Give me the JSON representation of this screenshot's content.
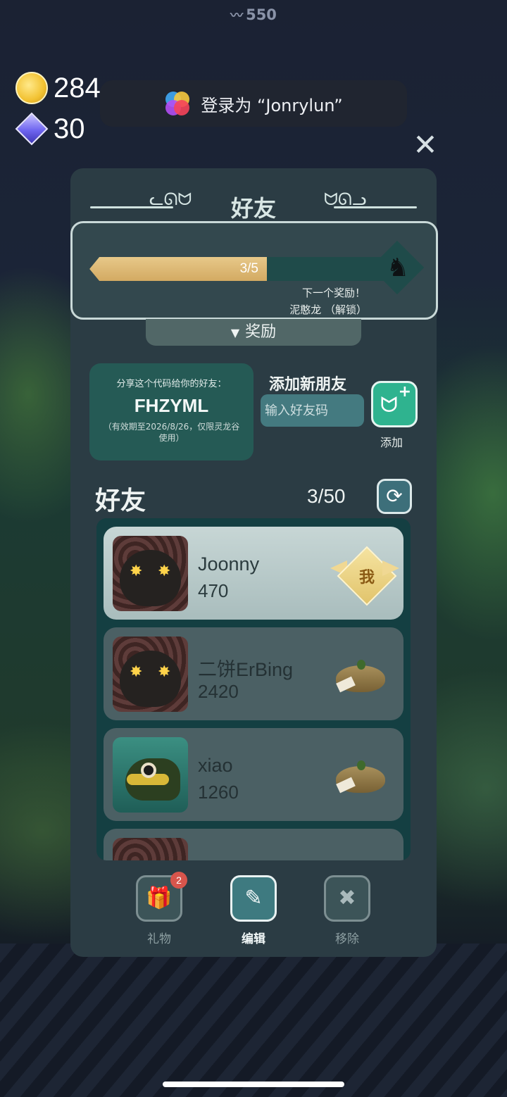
{
  "top_score": {
    "icon": "lizard-icon",
    "value": "550"
  },
  "currency": {
    "gold": "284",
    "gems": "30"
  },
  "login_banner": {
    "text": "登录为 “Jonrylun”"
  },
  "panel": {
    "title": "好友",
    "reward": {
      "progress_text": "3/5",
      "progress_fraction": 0.6,
      "next_reward_label": "下一个奖励！",
      "reward_name": "泥憨龙 （解锁）"
    },
    "reward_tab": {
      "label": "奖励"
    },
    "share_code": {
      "prompt": "分享这个代码给你的好友：",
      "code": "FHZYML",
      "validity": "（有效期至2026/8/26，仅限灵龙谷使用）"
    },
    "add_friend": {
      "title": "添加新朋友",
      "input_placeholder": "输入好友码",
      "button_label": "添加"
    },
    "friends": {
      "title": "好友",
      "count": "3/50",
      "list": [
        {
          "name": "Joonny",
          "score": "470",
          "badge": "我",
          "is_me": true
        },
        {
          "name": "二饼ErBing",
          "score": "2420",
          "is_me": false
        },
        {
          "name": "xiao",
          "score": "1260",
          "is_me": false
        }
      ]
    },
    "toolbar": {
      "gift_label": "礼物",
      "gift_badge": "2",
      "edit_label": "编辑",
      "remove_label": "移除"
    }
  },
  "colors": {
    "panel_bg": "#2b3c44",
    "accent_green": "#2fb38f",
    "progress_gold": "#d3aa62"
  }
}
